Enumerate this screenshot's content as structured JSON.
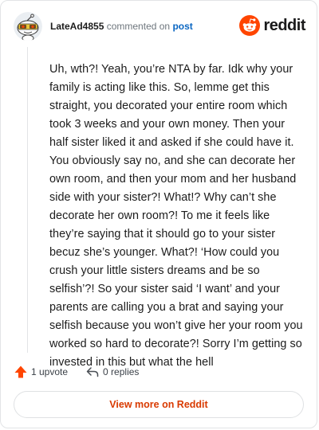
{
  "comment": {
    "username": "LateAd4855",
    "action_text": "commented on",
    "post_link_text": "post",
    "body": "Uh, wth?! Yeah, you’re NTA by far. Idk why your family is acting like this. So, lemme get this straight, you decorated your entire room which took 3 weeks and your own money. Then your half sister liked it and asked if she could have it. You obviously say no, and she can decorate her own room, and then your mom and her husband side with your sister?! What!? Why can’t she decorate her own room?! To me it feels like they’re saying that it should go to your sister becuz she’s younger. What?! ‘How could you crush your little sisters dreams and be so selfish’?! So your sister said ‘I want’ and your parents are calling you a brat and saying your selfish because you won’t give her your room you worked so hard to decorate?! Sorry I’m getting so invested in this but what the hell"
  },
  "brand": {
    "wordmark": "reddit",
    "icon": "reddit-snoo-icon",
    "color": "#ff4500"
  },
  "actions": {
    "upvote_label": "1 upvote",
    "upvote_icon": "upvote-arrow-icon",
    "reply_label": "0 replies",
    "reply_icon": "reply-arrow-icon"
  },
  "cta": {
    "label": "View more on Reddit"
  },
  "colors": {
    "accent": "#d93a00",
    "upvote": "#ff4500",
    "link": "#0a66c2",
    "muted": "#6e767d"
  }
}
